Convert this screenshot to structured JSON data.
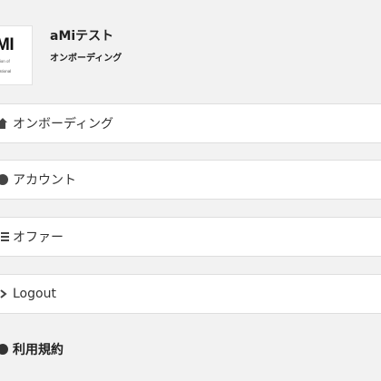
{
  "header": {
    "logo_mark": "MI",
    "logo_subtext": "iation of\ne\nrnational",
    "title": "aMiテスト",
    "subtitle": "オンボーディング"
  },
  "menu": [
    {
      "label": "オンボーディング",
      "icon": "onboarding-icon"
    },
    {
      "label": "アカウント",
      "icon": "account-icon"
    },
    {
      "label": "オファー",
      "icon": "list-icon"
    },
    {
      "label": "Logout",
      "icon": "logout-icon"
    },
    {
      "label": "利用規約",
      "icon": "info-icon"
    }
  ],
  "colors": {
    "background": "#f2f2f2",
    "row_background": "#ffffff",
    "border": "#dedede",
    "text": "#222222"
  }
}
